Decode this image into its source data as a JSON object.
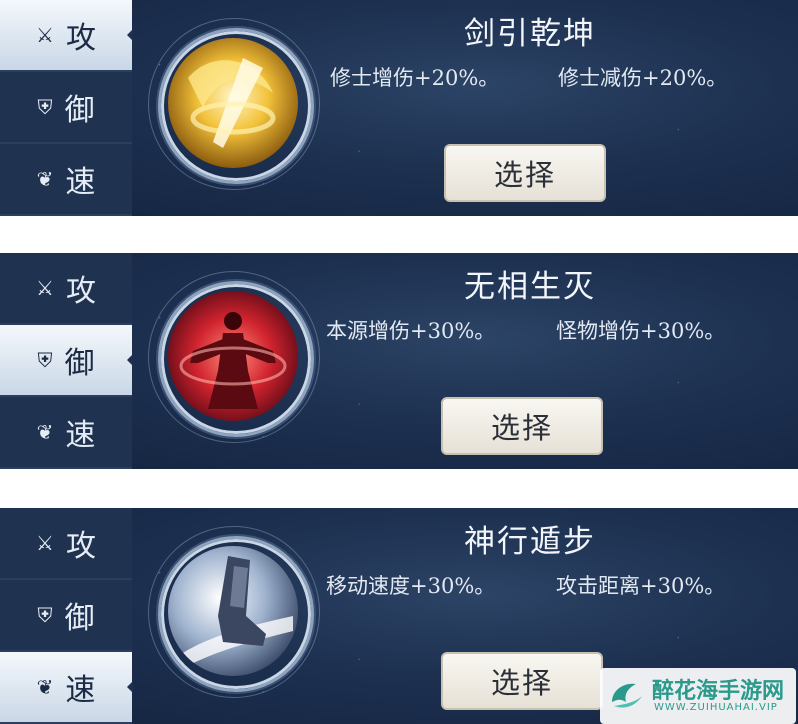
{
  "panels": [
    {
      "tabs": [
        {
          "icon": "⚔",
          "label": "攻",
          "active": true
        },
        {
          "icon": "⛨",
          "label": "御",
          "active": false
        },
        {
          "icon": "❦",
          "label": "速",
          "active": false
        }
      ],
      "skill_icon": "golden-sword-icon",
      "title": "剑引乾坤",
      "attr1": "修士增伤+20%。",
      "attr2": "修士减伤+20%。",
      "button": "选择"
    },
    {
      "tabs": [
        {
          "icon": "⚔",
          "label": "攻",
          "active": false
        },
        {
          "icon": "⛨",
          "label": "御",
          "active": true
        },
        {
          "icon": "❦",
          "label": "速",
          "active": false
        }
      ],
      "skill_icon": "red-figure-icon",
      "title": "无相生灭",
      "attr1": "本源增伤+30%。",
      "attr2": "怪物增伤+30%。",
      "button": "选择"
    },
    {
      "tabs": [
        {
          "icon": "⚔",
          "label": "攻",
          "active": false
        },
        {
          "icon": "⛨",
          "label": "御",
          "active": false
        },
        {
          "icon": "❦",
          "label": "速",
          "active": true
        }
      ],
      "skill_icon": "boot-icon",
      "title": "神行遁步",
      "attr1": "移动速度+30%。",
      "attr2": "攻击距离+30%。",
      "button": "选择"
    }
  ],
  "watermark": {
    "title": "醉花海手游网",
    "subtitle": "WWW.ZUIHUAHAI.VIP"
  },
  "colors": {
    "panel_bg": "#1d3050",
    "tab_active": "#e8eef6",
    "button_bg": "#f4f1ea",
    "watermark": "#2a9a8c"
  }
}
